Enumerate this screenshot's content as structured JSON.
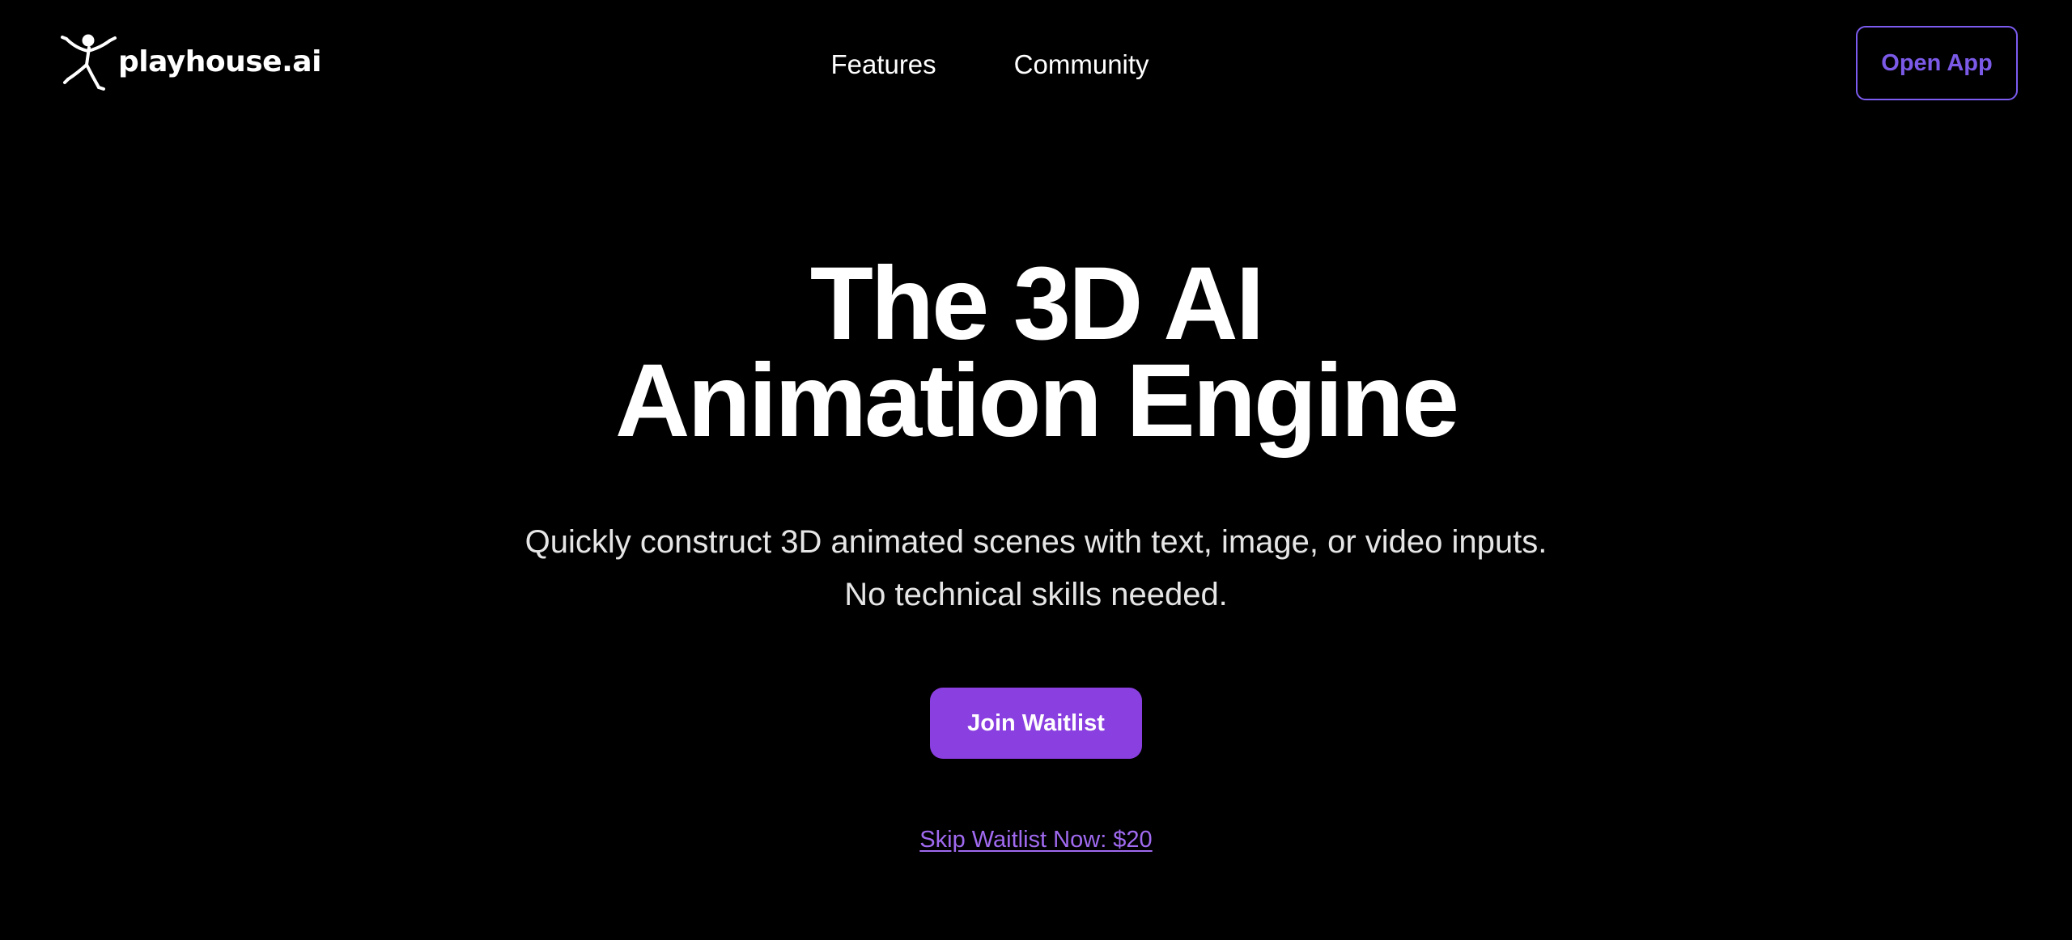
{
  "nav": {
    "logo_text": "playhouse.ai",
    "logo_icon": "stick-figure-icon",
    "links": [
      "Features",
      "Community"
    ],
    "open_app_label": "Open App"
  },
  "hero": {
    "title_line1": "The 3D AI",
    "title_line2": "Animation Engine",
    "subtitle": "Quickly construct 3D animated scenes with text, image, or video inputs. No technical skills needed.",
    "cta_label": "Join Waitlist",
    "skip_label": "Skip Waitlist Now: $20"
  },
  "colors": {
    "background": "#000000",
    "accent": "#8a3fe0",
    "open_app_border": "#7c5cf0",
    "link": "#a06af0"
  }
}
